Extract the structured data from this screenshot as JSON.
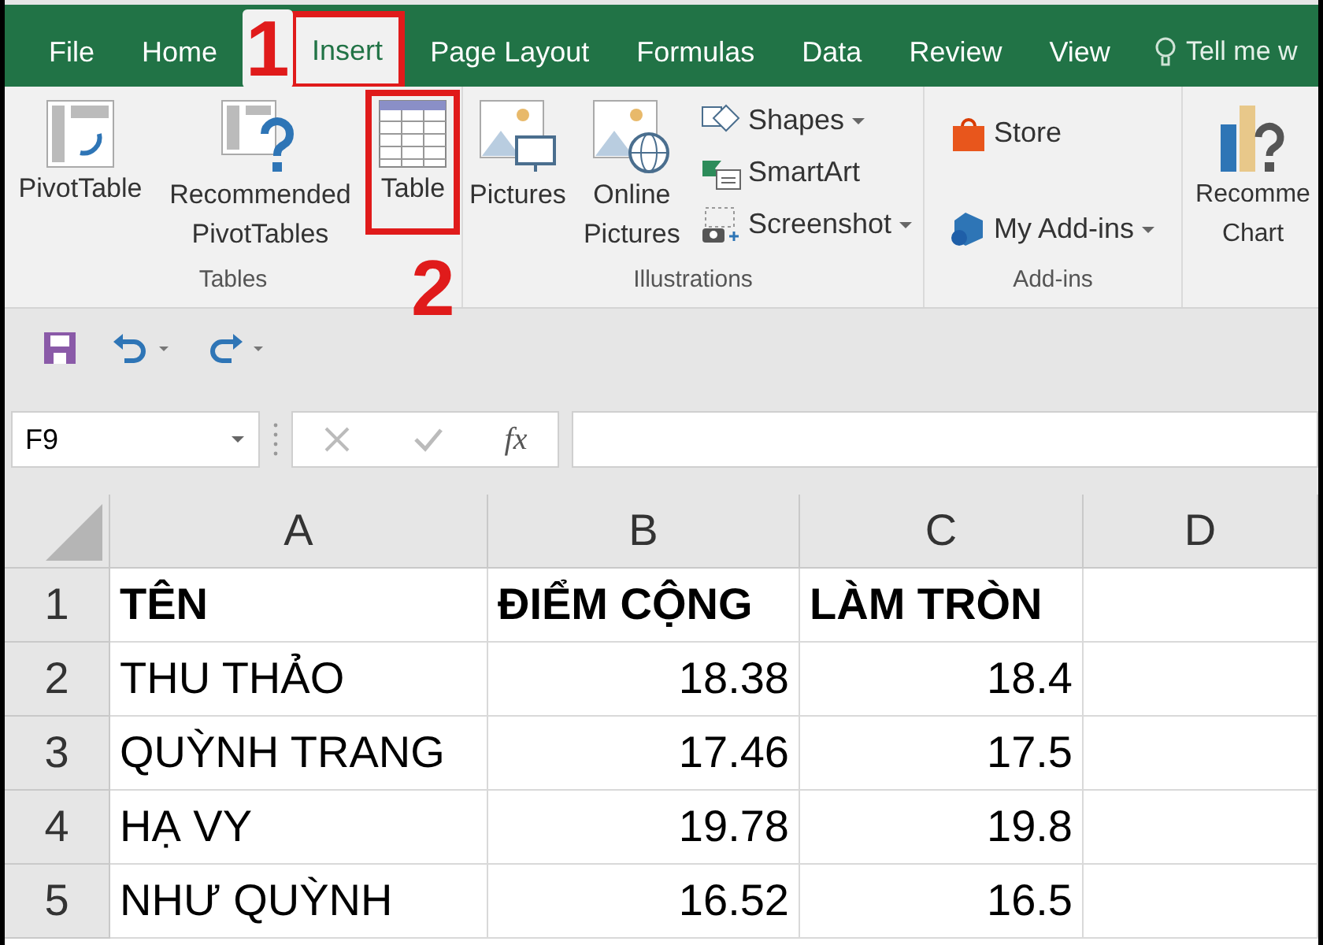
{
  "tabs": [
    {
      "label": "File",
      "selected": false,
      "highlighted": false
    },
    {
      "label": "Home",
      "selected": false,
      "highlighted": false
    },
    {
      "label": "Insert",
      "selected": true,
      "highlighted": true
    },
    {
      "label": "Page Layout",
      "selected": false,
      "highlighted": false
    },
    {
      "label": "Formulas",
      "selected": false,
      "highlighted": false
    },
    {
      "label": "Data",
      "selected": false,
      "highlighted": false
    },
    {
      "label": "Review",
      "selected": false,
      "highlighted": false
    },
    {
      "label": "View",
      "selected": false,
      "highlighted": false
    }
  ],
  "tell_me": "Tell me w",
  "ribbon": [
    {
      "label": "Tables",
      "items": [
        {
          "kind": "pivot",
          "label": "PivotTable",
          "highlighted": false
        },
        {
          "kind": "recommended_pivot",
          "label": "Recommended PivotTables",
          "highlighted": false
        },
        {
          "kind": "table",
          "label": "Table",
          "highlighted": true
        }
      ]
    },
    {
      "label": "Illustrations",
      "items": [
        {
          "kind": "pictures",
          "label": "Pictures",
          "highlighted": false
        },
        {
          "kind": "online_pictures",
          "label": "Online Pictures",
          "highlighted": false
        },
        {
          "kind": "stack",
          "entries": [
            {
              "kind": "shapes",
              "label": "Shapes",
              "dropdown": true
            },
            {
              "kind": "smartart",
              "label": "SmartArt",
              "dropdown": false
            },
            {
              "kind": "screenshot",
              "label": "Screenshot",
              "dropdown": true
            }
          ]
        }
      ]
    },
    {
      "label": "Add-ins",
      "items": [
        {
          "kind": "stack",
          "entries": [
            {
              "kind": "store",
              "label": "Store",
              "dropdown": false
            },
            {
              "kind": "addins",
              "label": "My Add-ins",
              "dropdown": true
            }
          ]
        }
      ]
    },
    {
      "items": [
        {
          "kind": "recommended_charts",
          "label": "Recomme Chart",
          "highlighted": false
        }
      ]
    }
  ],
  "steps": [
    {
      "label": "1"
    },
    {
      "label": "2"
    }
  ],
  "name_box": "F9",
  "fx": "fx",
  "columns": [
    "A",
    "B",
    "C",
    "D"
  ],
  "rows": [
    {
      "number": "1",
      "cells": [
        "TÊN",
        "ĐIỂM CỘNG",
        "LÀM TRÒN",
        ""
      ],
      "header": true
    },
    {
      "number": "2",
      "cells": [
        "THU THẢO",
        "18.38",
        "18.4",
        ""
      ],
      "header": false
    },
    {
      "number": "3",
      "cells": [
        "QUỲNH TRANG",
        "17.46",
        "17.5",
        ""
      ],
      "header": false
    },
    {
      "number": "4",
      "cells": [
        "HẠ VY",
        "19.78",
        "19.8",
        ""
      ],
      "header": false
    },
    {
      "number": "5",
      "cells": [
        "NHƯ QUỲNH",
        "16.52",
        "16.5",
        ""
      ],
      "header": false
    }
  ]
}
